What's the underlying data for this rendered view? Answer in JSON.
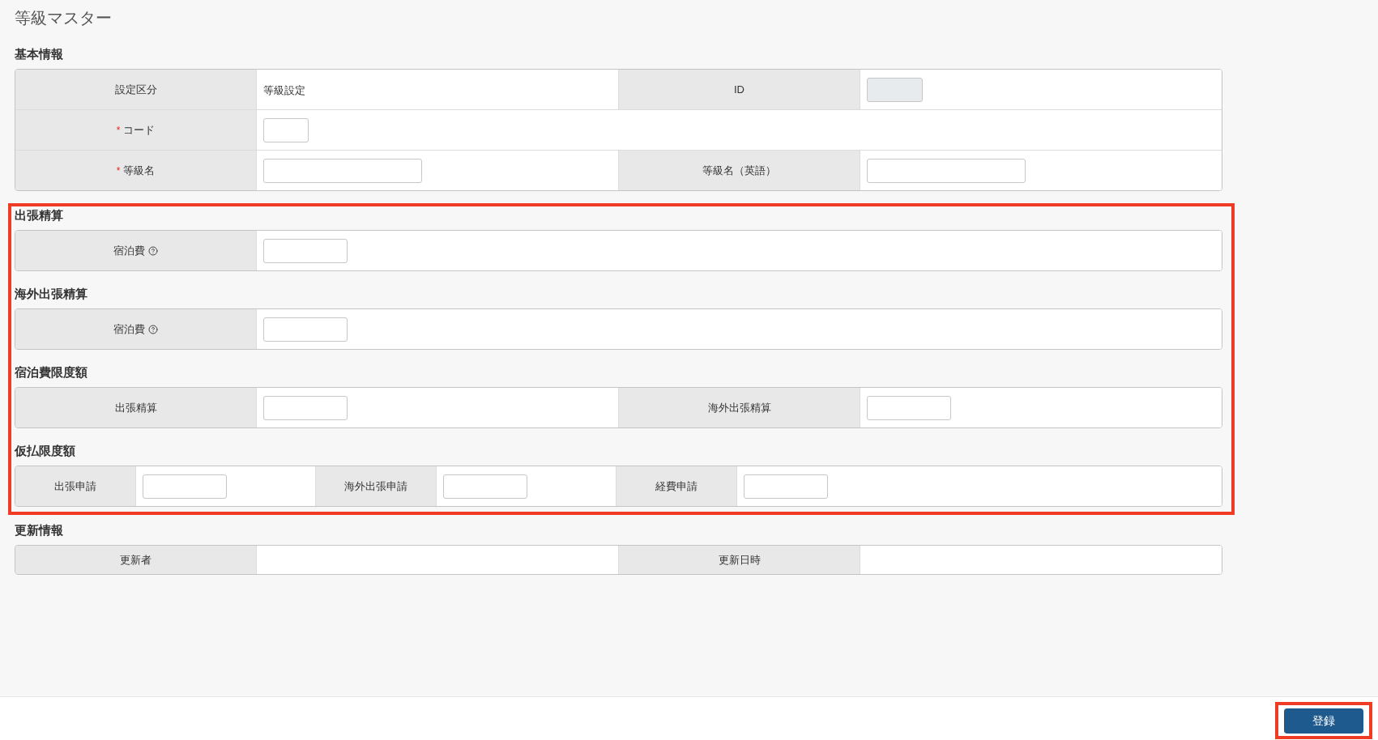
{
  "page_title": "等級マスター",
  "sections": [
    {
      "heading": "基本情報",
      "highlighted": false,
      "rows": [
        {
          "fields": [
            {
              "label": "設定区分",
              "value": {
                "kind": "text",
                "text": "等級設定"
              }
            },
            {
              "label": "ID",
              "value": {
                "kind": "id",
                "disabled": true
              }
            }
          ]
        },
        {
          "fields": [
            {
              "label": "コード",
              "required_mark": "*",
              "value": {
                "kind": "code",
                "disabled": false
              }
            }
          ]
        },
        {
          "fields": [
            {
              "label": "等級名",
              "required_mark": "*",
              "value": {
                "kind": "name",
                "disabled": false
              }
            },
            {
              "label": "等級名（英語）",
              "value": {
                "kind": "name",
                "disabled": false
              }
            }
          ]
        }
      ]
    },
    {
      "heading": "出張精算",
      "highlighted": true,
      "rows": [
        {
          "fields": [
            {
              "label": "宿泊費",
              "help": true,
              "value": {
                "kind": "amount",
                "disabled": false
              }
            }
          ]
        }
      ]
    },
    {
      "heading": "海外出張精算",
      "highlighted": true,
      "rows": [
        {
          "fields": [
            {
              "label": "宿泊費",
              "help": true,
              "value": {
                "kind": "amount",
                "disabled": false
              }
            }
          ]
        }
      ]
    },
    {
      "heading": "宿泊費限度額",
      "highlighted": true,
      "rows": [
        {
          "fields": [
            {
              "label": "出張精算",
              "value": {
                "kind": "amount",
                "disabled": false
              }
            },
            {
              "label": "海外出張精算",
              "value": {
                "kind": "amount",
                "disabled": false
              }
            }
          ]
        }
      ]
    },
    {
      "heading": "仮払限度額",
      "highlighted": true,
      "rows": [
        {
          "fields": [
            {
              "label": "出張申請",
              "value": {
                "kind": "amount",
                "disabled": false
              }
            },
            {
              "label": "海外出張申請",
              "value": {
                "kind": "amount",
                "disabled": false
              }
            },
            {
              "label": "経費申請",
              "value": {
                "kind": "amount",
                "disabled": false
              }
            }
          ]
        }
      ]
    },
    {
      "heading": "更新情報",
      "highlighted": false,
      "rows": [
        {
          "fields": [
            {
              "label": "更新者"
            },
            {
              "label": "更新日時"
            }
          ]
        }
      ]
    }
  ],
  "footer": {
    "submit": {
      "label": "登録",
      "highlighted": true
    }
  }
}
